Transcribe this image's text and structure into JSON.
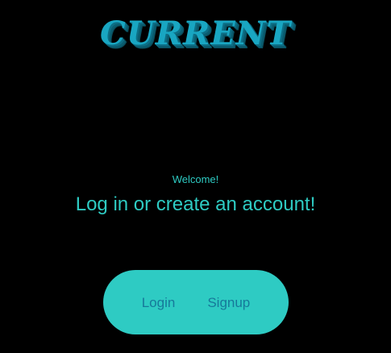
{
  "logo": {
    "text": "CURRENT"
  },
  "intro": {
    "welcome": "Welcome!",
    "headline": "Log in or create an account!"
  },
  "actions": {
    "login_label": "Login",
    "signup_label": "Signup"
  },
  "colors": {
    "background": "#000000",
    "accent": "#2ecbc3",
    "logo": "#19a6c2",
    "button_text": "#16799a"
  }
}
